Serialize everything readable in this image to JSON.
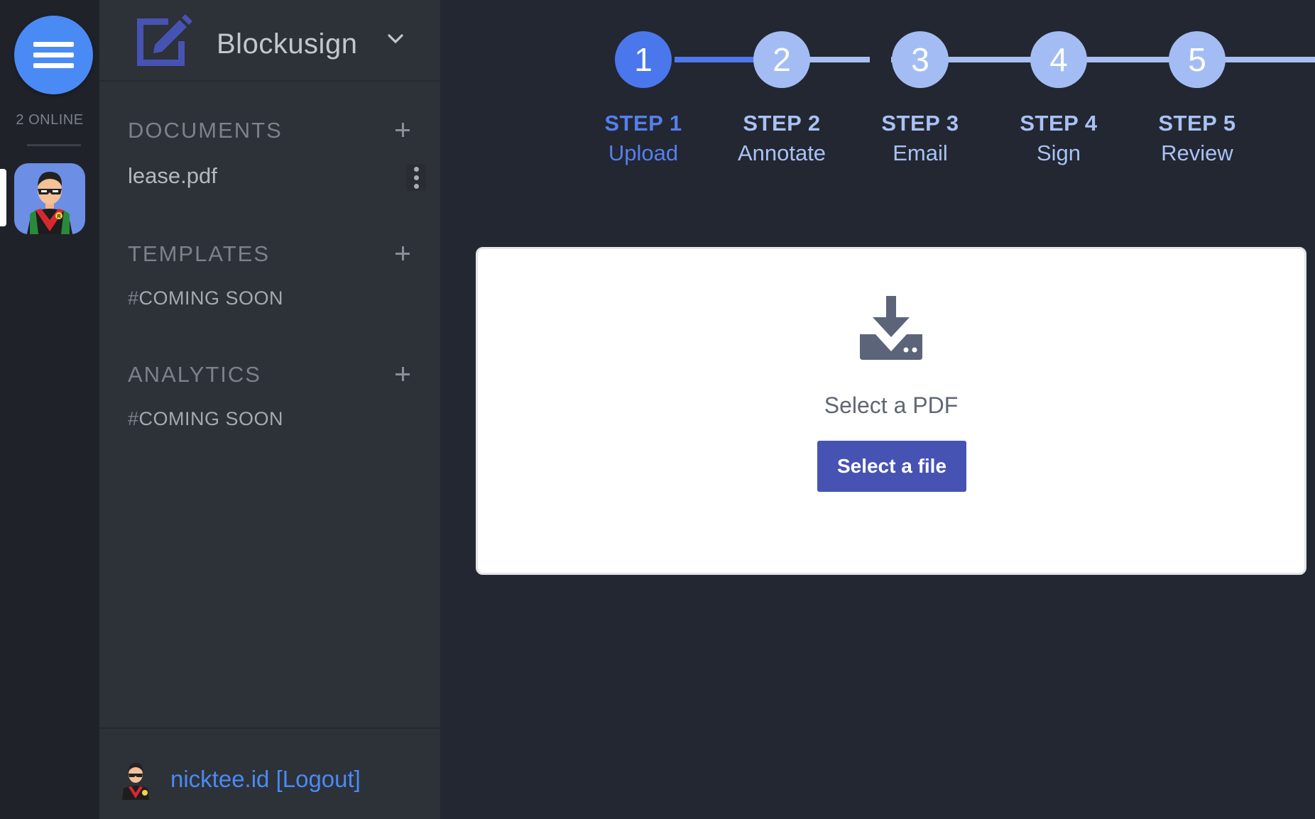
{
  "rail": {
    "online_text": "2 ONLINE",
    "menu_icon": "hamburger-icon",
    "avatar": "superhero-avatar"
  },
  "brand": {
    "name": "Blockusign",
    "icon": "edit-document-icon",
    "chevron": "chevron-down-icon"
  },
  "sidebar": {
    "documents": {
      "title": "DOCUMENTS",
      "items": [
        {
          "label": "lease.pdf",
          "menu_icon": "more-vertical-icon"
        }
      ]
    },
    "templates": {
      "title": "TEMPLATES",
      "hash": "#",
      "placeholder": "COMING SOON"
    },
    "analytics": {
      "title": "ANALYTICS",
      "hash": "#",
      "placeholder": "COMING SOON"
    },
    "footer": {
      "user_text": "nicktee.id [Logout]"
    }
  },
  "steps": [
    {
      "number": "1",
      "title": "STEP 1",
      "label": "Upload",
      "active": true
    },
    {
      "number": "2",
      "title": "STEP 2",
      "label": "Annotate",
      "active": false
    },
    {
      "number": "3",
      "title": "STEP 3",
      "label": "Email",
      "active": false
    },
    {
      "number": "4",
      "title": "STEP 4",
      "label": "Sign",
      "active": false
    },
    {
      "number": "5",
      "title": "STEP 5",
      "label": "Review",
      "active": false
    }
  ],
  "upload": {
    "icon": "download-tray-icon",
    "prompt": "Select a PDF",
    "button_label": "Select a file"
  },
  "colors": {
    "accent": "#4a8af4",
    "step_active": "#4b77ed",
    "step_inactive": "#a3bdf4",
    "button": "#4753b3"
  }
}
